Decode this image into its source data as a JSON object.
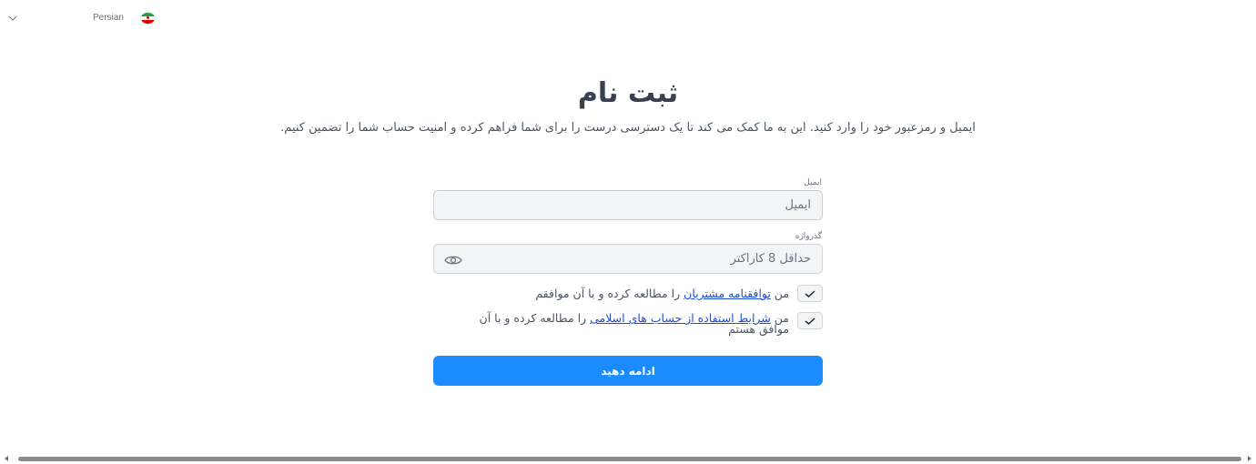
{
  "language": {
    "label": "Persian",
    "flag": "iran-flag-icon"
  },
  "page": {
    "title": "ثبت نام",
    "subtitle": "ایمیل و رمزعبور خود را وارد کنید. این به ما کمک می کند تا یک دسترسی درست را برای شما فراهم کرده و امنیت حساب شما را تضمین کنیم."
  },
  "form": {
    "email": {
      "label": "ایمیل",
      "placeholder": "ایمیل",
      "value": ""
    },
    "password": {
      "label": "گذرواژه",
      "placeholder": "حداقل 8 کاراکتر",
      "value": ""
    },
    "agreement1": {
      "prefix": "من ",
      "link": "توافقنامه مشتریان",
      "suffix": " را مطالعه کرده و با آن موافقم",
      "checked": true
    },
    "agreement2": {
      "prefix": "من ",
      "link": "شرایط استفاده از حساب های اسلامی",
      "suffix": " را مطالعه کرده و با آن موافق هستم",
      "checked": true
    },
    "submit_label": "ادامه دهید"
  },
  "colors": {
    "primary": "#1a8cff",
    "link": "#1d4ed8",
    "field_bg": "#f3f4f6"
  }
}
